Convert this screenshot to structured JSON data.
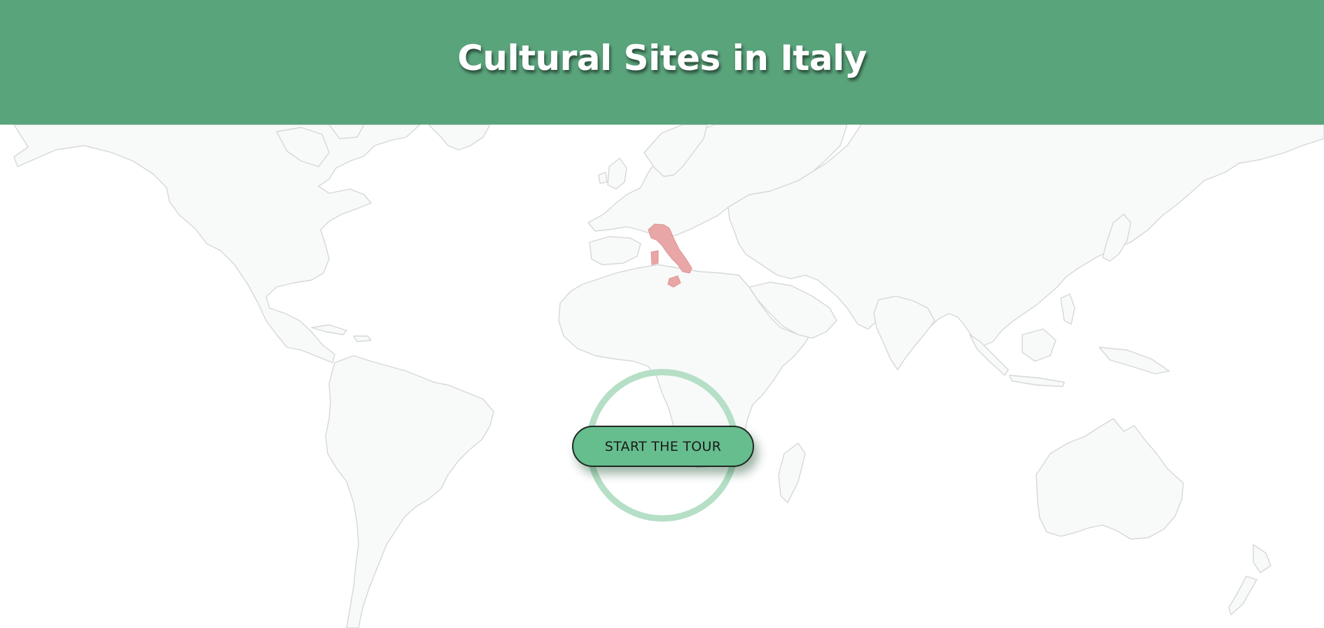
{
  "header": {
    "title": "Cultural Sites in Italy",
    "background_color": "#5aa47c"
  },
  "map": {
    "type": "world-outline",
    "highlighted_country": "Italy",
    "highlight_color": "#e9a6a6",
    "land_color": "#f8f9f9",
    "border_color": "#d6d8d8"
  },
  "cta": {
    "label": "START THE TOUR",
    "button_color": "#66bd8e",
    "ring_color": "#b5dfc6"
  }
}
